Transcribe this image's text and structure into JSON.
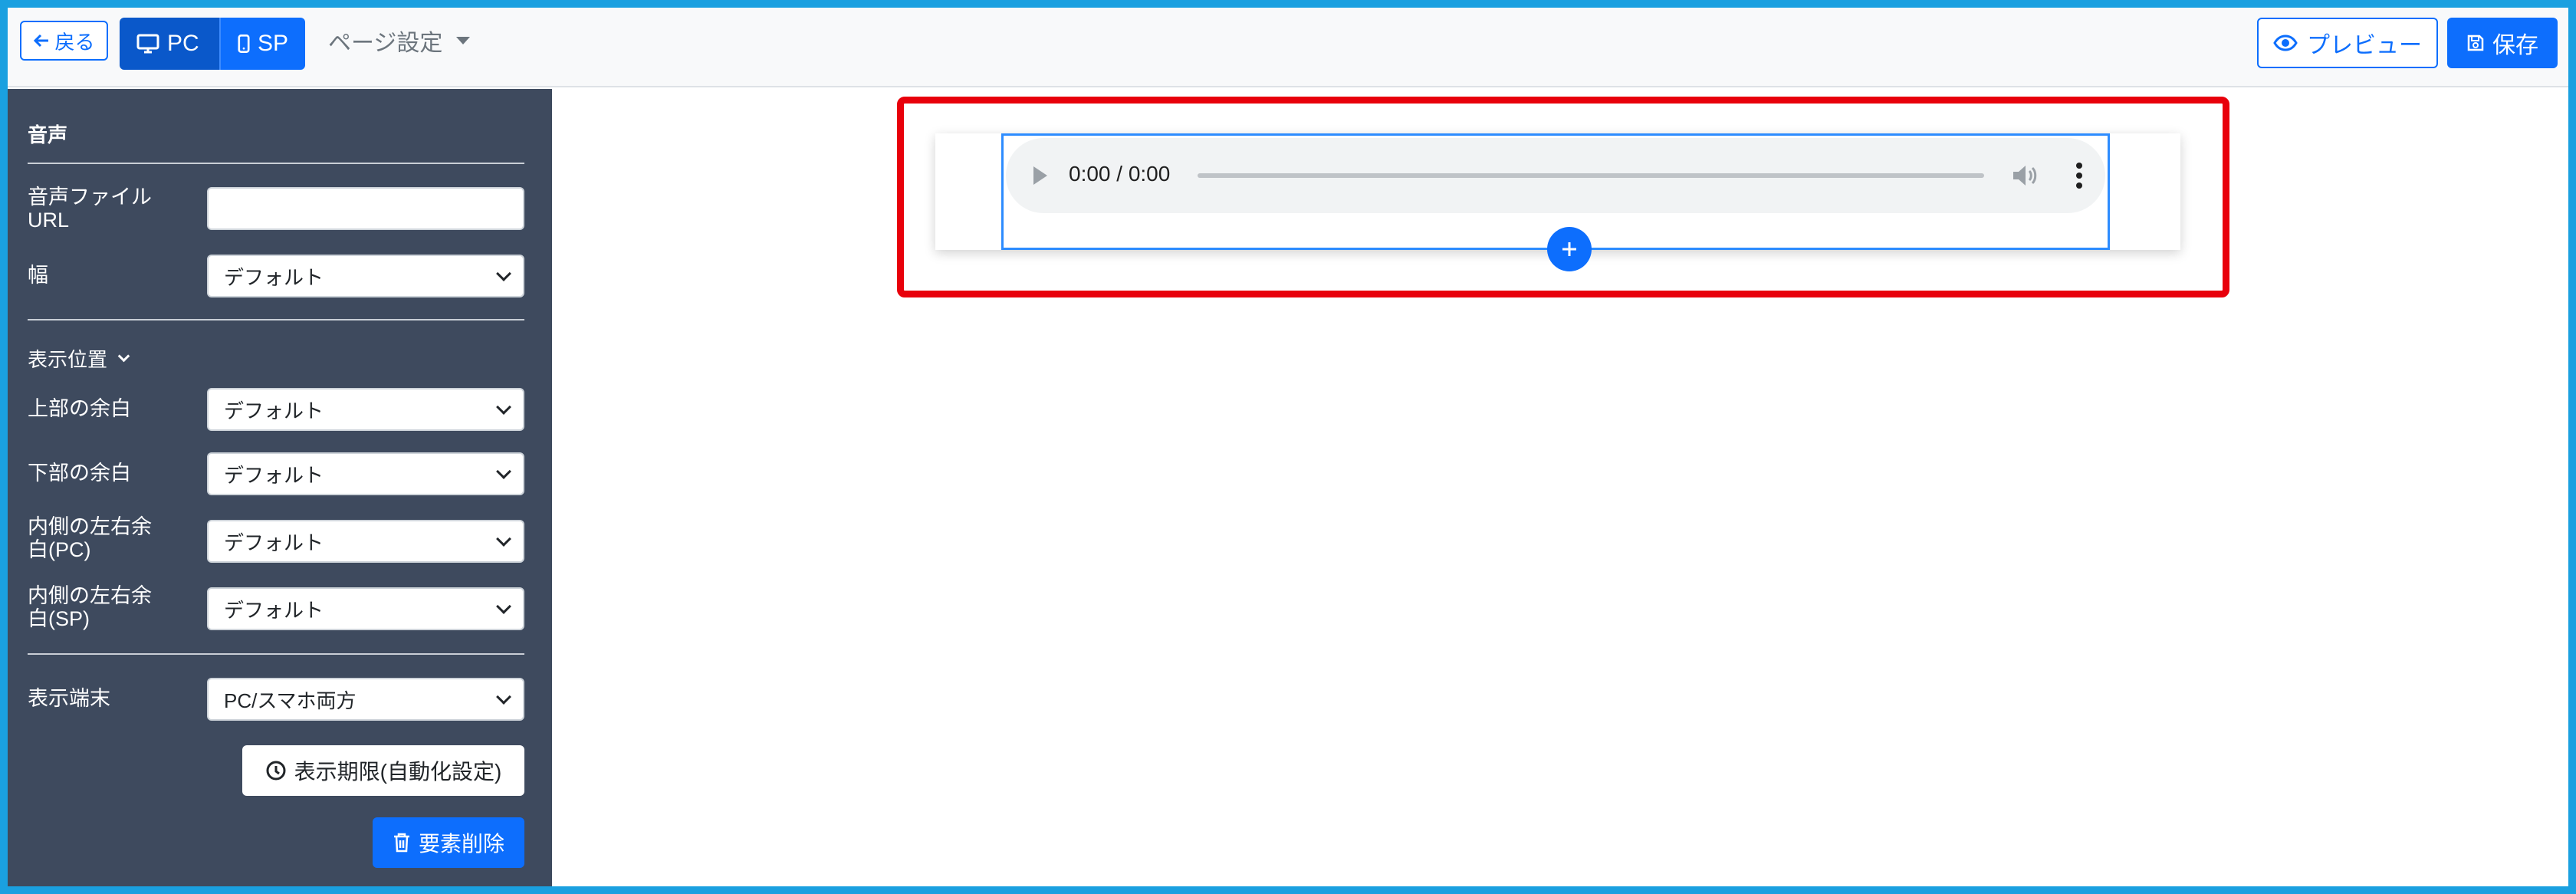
{
  "toolbar": {
    "back_label": "戻る",
    "pc_label": "PC",
    "sp_label": "SP",
    "page_settings_label": "ページ設定",
    "preview_label": "プレビュー",
    "save_label": "保存"
  },
  "sidebar": {
    "title": "音声",
    "audio_url_label": "音声ファイル\nURL",
    "audio_url_value": "",
    "width_label": "幅",
    "width_value": "デフォルト",
    "display_position_label": "表示位置",
    "top_margin_label": "上部の余白",
    "top_margin_value": "デフォルト",
    "bottom_margin_label": "下部の余白",
    "bottom_margin_value": "デフォルト",
    "inner_pc_label": "内側の左右余\n白(PC)",
    "inner_pc_value": "デフォルト",
    "inner_sp_label": "内側の左右余\n白(SP)",
    "inner_sp_value": "デフォルト",
    "device_label": "表示端末",
    "device_value": "PC/スマホ両方",
    "schedule_button": "表示期限(自動化設定)",
    "delete_button": "要素削除"
  },
  "audio_player": {
    "time": "0:00 / 0:00"
  },
  "colors": {
    "primary": "#0d6efd",
    "sidebar_bg": "#3e4a5e",
    "highlight": "#e8000b"
  }
}
